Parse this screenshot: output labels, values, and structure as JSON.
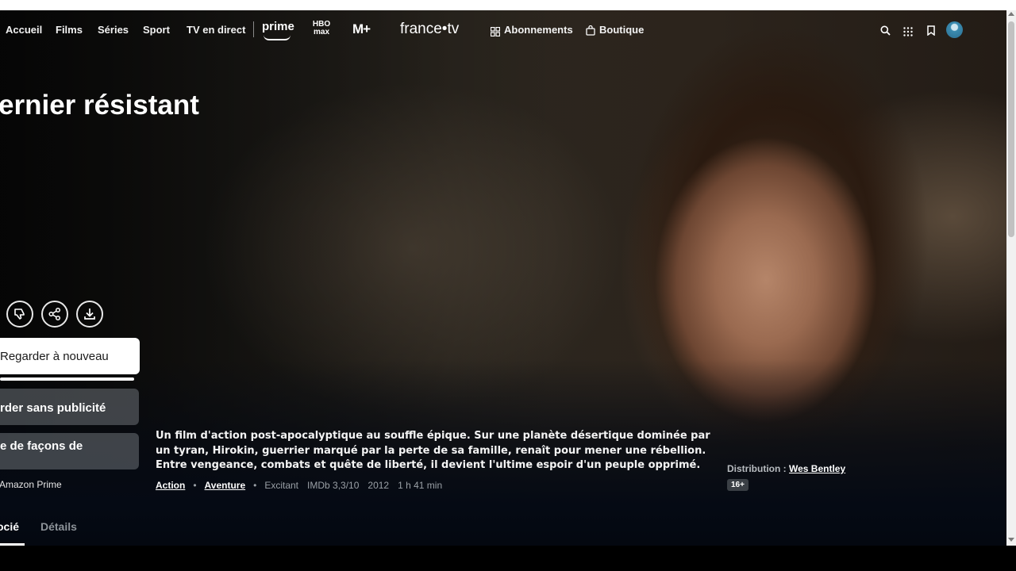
{
  "nav": {
    "items": [
      "Accueil",
      "Films",
      "Séries",
      "Sport",
      "TV en direct"
    ],
    "logos": {
      "prime": "prime",
      "hbo_top": "HBO",
      "hbo_bottom": "max",
      "mplus": "M+",
      "francetv": "france•tv"
    },
    "abonnements": "Abonnements",
    "boutique": "Boutique",
    "icons": [
      "search-icon",
      "apps-grid-icon",
      "bookmark-icon",
      "profile-avatar"
    ]
  },
  "movie": {
    "title": "ernier résistant",
    "actions": [
      "thumbs-down-icon",
      "share-icon",
      "download-icon"
    ],
    "watch_again": "Regarder à nouveau",
    "watch_progress": 1.0,
    "no_ads": "rder sans publicité",
    "more_ways": "e de façons de",
    "prime_note": "Amazon Prime",
    "description": "Un film d'action post-apocalyptique au souffle épique. Sur une planète désertique dominée par un tyran, Hirokin, guerrier marqué par la perte de sa famille, renaît pour mener une rébellion. Entre vengeance, combats et quête de liberté, il devient l'ultime espoir d'un peuple opprimé.",
    "genres": [
      "Action",
      "Aventure"
    ],
    "mood": "Excitant",
    "imdb": "IMDb 3,3/10",
    "year": "2012",
    "duration": "1 h 41 min",
    "distribution_label": "Distribution :",
    "distribution_name": "Wes Bentley",
    "rating": "16+"
  },
  "tabs": [
    "ocié",
    "Détails"
  ],
  "colors": {
    "accent": "#ffffff",
    "muted": "#9aa0a6",
    "button_grey": "#5f6468",
    "badge": "#3a3f45"
  }
}
